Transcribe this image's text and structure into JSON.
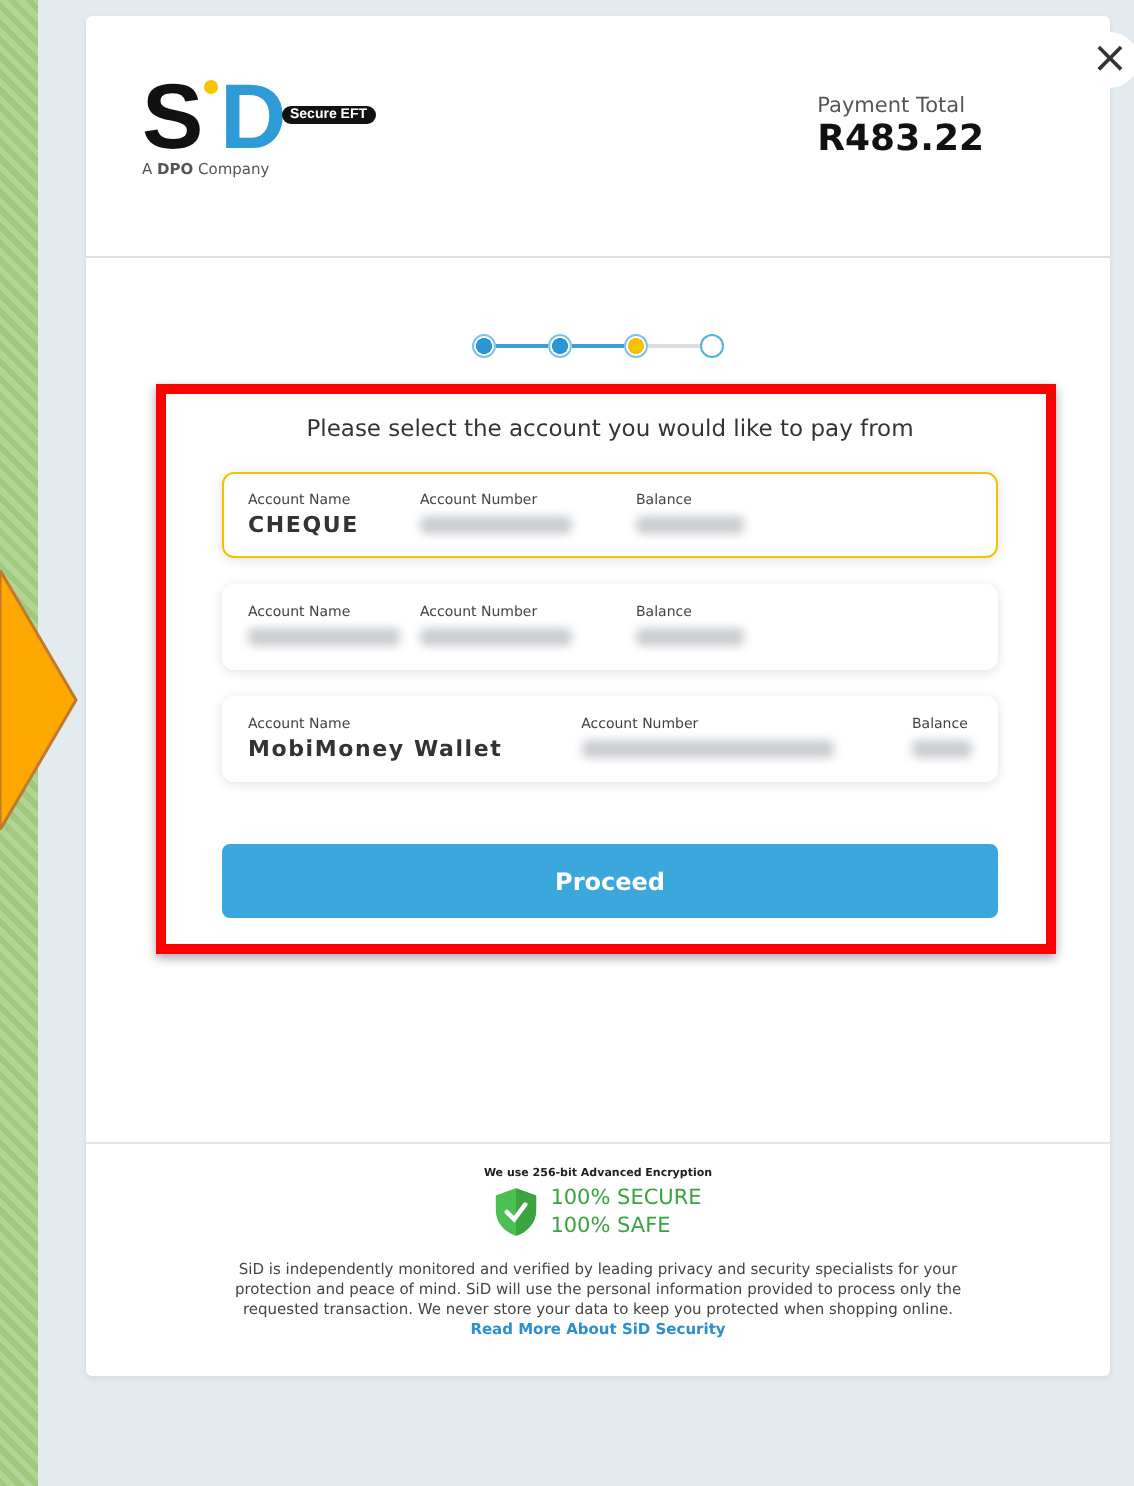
{
  "logo": {
    "first_letter": "S",
    "last_letter": "D",
    "badge": "Secure EFT",
    "tagline": "A **DPO** Company"
  },
  "payment_total": {
    "label": "Payment Total",
    "amount": "R483.22"
  },
  "steps": [
    {
      "kind": "done"
    },
    {
      "kind": "done"
    },
    {
      "kind": "current"
    },
    {
      "kind": "todo"
    }
  ],
  "prompt": "Please select the account you would like to pay from",
  "accounts": [
    {
      "selected": true,
      "spread": false,
      "fields": [
        {
          "label": "Account Name",
          "value": "CHEQUE",
          "blurred": false
        },
        {
          "label": "Account Number",
          "blurred": true
        },
        {
          "label": "Balance",
          "blurred": true
        }
      ]
    },
    {
      "selected": false,
      "spread": false,
      "fields": [
        {
          "label": "Account Name",
          "blurred": true
        },
        {
          "label": "Account Number",
          "blurred": true
        },
        {
          "label": "Balance",
          "blurred": true
        }
      ]
    },
    {
      "selected": false,
      "spread": true,
      "fields": [
        {
          "label": "Account Name",
          "value": "MobiMoney Wallet",
          "blurred": false
        },
        {
          "label": "Account Number",
          "blurred": true
        },
        {
          "label": "Balance",
          "blurred": true
        }
      ]
    }
  ],
  "proceed_button": "Proceed",
  "security": {
    "encryption": "We use 256-bit Advanced Encryption",
    "secure": "100% SECURE",
    "safe": "100% SAFE",
    "text": "SiD is independently monitored and verified by leading privacy and security specialists for your protection and peace of mind. SiD will use the personal information provided to process only the requested transaction. We never store your data to keep you protected when shopping online.",
    "link": "Read More About SiD Security"
  },
  "close_button": "×"
}
